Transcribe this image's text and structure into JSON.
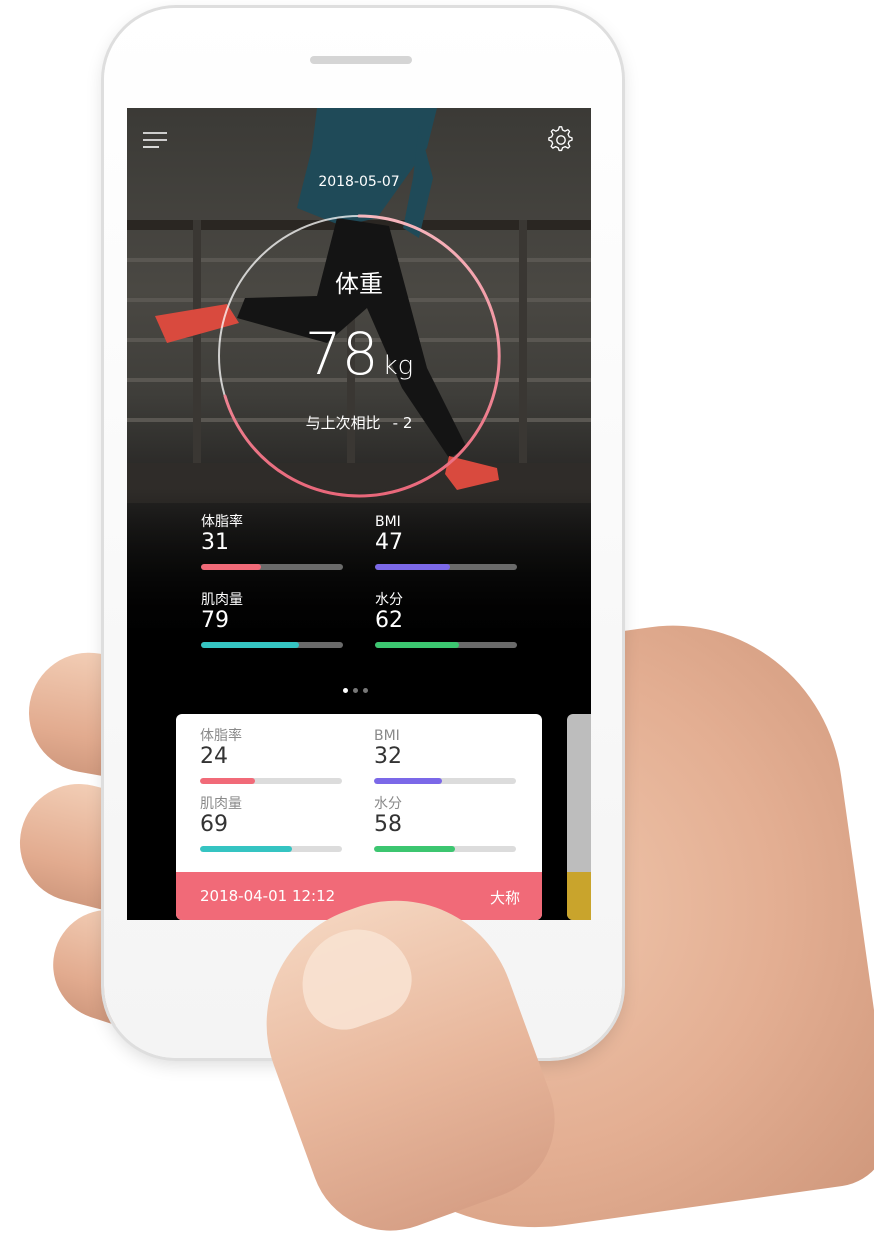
{
  "header": {
    "menu_icon": "menu-icon",
    "settings_icon": "gear-icon",
    "date": "2018-05-07"
  },
  "weight": {
    "label": "体重",
    "value": "78",
    "unit": "kg",
    "compare_label": "与上次相比",
    "compare_delta": "- 2"
  },
  "metrics": [
    {
      "label": "体脂率",
      "value": "31",
      "fill": 0.42,
      "color": "#f16a78"
    },
    {
      "label": "BMI",
      "value": "47",
      "fill": 0.53,
      "color": "#7b68e8"
    },
    {
      "label": "肌肉量",
      "value": "79",
      "fill": 0.69,
      "color": "#35c4c2"
    },
    {
      "label": "水分",
      "value": "62",
      "fill": 0.59,
      "color": "#3cc670"
    }
  ],
  "pager": {
    "count": 3,
    "active": 0
  },
  "history_card": {
    "metrics": [
      {
        "label": "体脂率",
        "value": "24",
        "fill": 0.39,
        "color": "#f16a78"
      },
      {
        "label": "BMI",
        "value": "32",
        "fill": 0.48,
        "color": "#7b68e8"
      },
      {
        "label": "肌肉量",
        "value": "69",
        "fill": 0.65,
        "color": "#35c4c2"
      },
      {
        "label": "水分",
        "value": "58",
        "fill": 0.57,
        "color": "#3cc670"
      }
    ],
    "datetime": "2018-04-01  12:12",
    "source": "大称"
  },
  "colors": {
    "accent": "#f16a78",
    "ring_start": "#f7b6bd",
    "ring_end": "#e9677a"
  }
}
